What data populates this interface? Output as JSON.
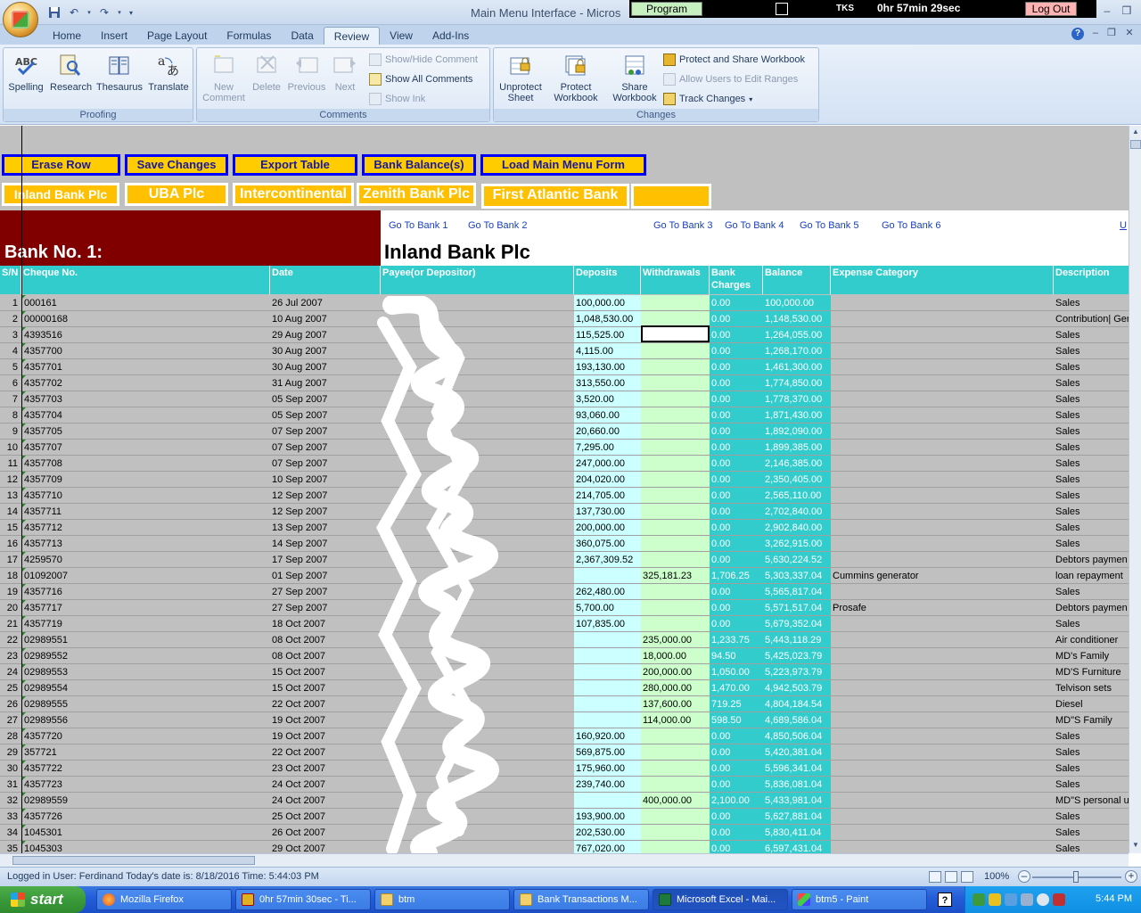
{
  "window": {
    "title": "Main Menu Interface - Micros",
    "program_label": "Program",
    "tks_label": "TKS",
    "timer": "0hr 57min 29sec",
    "logout_label": "Log Out",
    "minimize": "–",
    "restore": "❒",
    "close": "✕"
  },
  "ribbon": {
    "tabs": [
      "Home",
      "Insert",
      "Page Layout",
      "Formulas",
      "Data",
      "Review",
      "View",
      "Add-Ins"
    ],
    "active_tab": "Review",
    "groups": {
      "proofing": {
        "label": "Proofing",
        "buttons": [
          "Spelling",
          "Research",
          "Thesaurus",
          "Translate"
        ]
      },
      "comments": {
        "label": "Comments",
        "new_comment": "New Comment",
        "delete": "Delete",
        "previous": "Previous",
        "next": "Next",
        "show_hide": "Show/Hide Comment",
        "show_all": "Show All Comments",
        "show_ink": "Show Ink"
      },
      "changes": {
        "label": "Changes",
        "unprotect_sheet": "Unprotect Sheet",
        "protect_workbook": "Protect Workbook",
        "share_workbook": "Share Workbook",
        "protect_share": "Protect and Share Workbook",
        "allow_users": "Allow Users to Edit Ranges",
        "track_changes": "Track Changes"
      }
    }
  },
  "actions": [
    "Erase Row",
    "Save Changes",
    "Export Table",
    "Bank Balance(s)",
    "Load Main Menu Form"
  ],
  "banks": [
    "Inland Bank Plc",
    "UBA Plc",
    "Intercontinental",
    "Zenith Bank Plc",
    "First Atlantic Bank",
    ""
  ],
  "goto_links": [
    "Go To Bank 1",
    "Go To Bank 2",
    "Go To Bank 3",
    "Go To Bank 4",
    "Go To Bank 5",
    "Go To Bank 6",
    "U"
  ],
  "bank_no": "Bank No. 1:",
  "bank_title": "Inland Bank Plc",
  "table": {
    "headers": {
      "sn": "S/N",
      "cheque": "Cheque No.",
      "date": "Date",
      "payee": "Payee(or Depositor)",
      "deposits": "Deposits",
      "withdrawals": "Withdrawals",
      "charges": "Bank Charges",
      "balance": "Balance",
      "expense": "Expense Category",
      "description": "Description"
    },
    "rows": [
      {
        "sn": "1",
        "cheque": "000161",
        "date": "26 Jul 2007",
        "dep": "100,000.00",
        "wd": "",
        "chg": "0.00",
        "bal": "100,000.00",
        "exp": "",
        "desc": "Sales"
      },
      {
        "sn": "2",
        "cheque": "00000168",
        "date": "10 Aug 2007",
        "dep": "1,048,530.00",
        "wd": "",
        "chg": "0.00",
        "bal": "1,148,530.00",
        "exp": "",
        "desc": "Contribution| Ger"
      },
      {
        "sn": "3",
        "cheque": "4393516",
        "date": "29 Aug 2007",
        "dep": "115,525.00",
        "wd": "",
        "chg": "0.00",
        "bal": "1,264,055.00",
        "exp": "",
        "desc": "Sales"
      },
      {
        "sn": "4",
        "cheque": "4357700",
        "date": "30 Aug 2007",
        "dep": "4,115.00",
        "wd": "",
        "chg": "0.00",
        "bal": "1,268,170.00",
        "exp": "",
        "desc": "Sales"
      },
      {
        "sn": "5",
        "cheque": "4357701",
        "date": "30 Aug 2007",
        "dep": "193,130.00",
        "wd": "",
        "chg": "0.00",
        "bal": "1,461,300.00",
        "exp": "",
        "desc": "Sales"
      },
      {
        "sn": "6",
        "cheque": "4357702",
        "date": "31 Aug 2007",
        "dep": "313,550.00",
        "wd": "",
        "chg": "0.00",
        "bal": "1,774,850.00",
        "exp": "",
        "desc": "Sales"
      },
      {
        "sn": "7",
        "cheque": "4357703",
        "date": "05 Sep 2007",
        "dep": "3,520.00",
        "wd": "",
        "chg": "0.00",
        "bal": "1,778,370.00",
        "exp": "",
        "desc": "Sales"
      },
      {
        "sn": "8",
        "cheque": "4357704",
        "date": "05 Sep 2007",
        "dep": "93,060.00",
        "wd": "",
        "chg": "0.00",
        "bal": "1,871,430.00",
        "exp": "",
        "desc": "Sales"
      },
      {
        "sn": "9",
        "cheque": "4357705",
        "date": "07 Sep 2007",
        "dep": "20,660.00",
        "wd": "",
        "chg": "0.00",
        "bal": "1,892,090.00",
        "exp": "",
        "desc": "Sales"
      },
      {
        "sn": "10",
        "cheque": "4357707",
        "date": "07 Sep 2007",
        "dep": "7,295.00",
        "wd": "",
        "chg": "0.00",
        "bal": "1,899,385.00",
        "exp": "",
        "desc": "Sales"
      },
      {
        "sn": "11",
        "cheque": "4357708",
        "date": "07 Sep 2007",
        "dep": "247,000.00",
        "wd": "",
        "chg": "0.00",
        "bal": "2,146,385.00",
        "exp": "",
        "desc": "Sales"
      },
      {
        "sn": "12",
        "cheque": "4357709",
        "date": "10 Sep 2007",
        "dep": "204,020.00",
        "wd": "",
        "chg": "0.00",
        "bal": "2,350,405.00",
        "exp": "",
        "desc": "Sales"
      },
      {
        "sn": "13",
        "cheque": "4357710",
        "date": "12 Sep 2007",
        "dep": "214,705.00",
        "wd": "",
        "chg": "0.00",
        "bal": "2,565,110.00",
        "exp": "",
        "desc": "Sales"
      },
      {
        "sn": "14",
        "cheque": "4357711",
        "date": "12 Sep 2007",
        "dep": "137,730.00",
        "wd": "",
        "chg": "0.00",
        "bal": "2,702,840.00",
        "exp": "",
        "desc": "Sales"
      },
      {
        "sn": "15",
        "cheque": "4357712",
        "date": "13 Sep 2007",
        "dep": "200,000.00",
        "wd": "",
        "chg": "0.00",
        "bal": "2,902,840.00",
        "exp": "",
        "desc": "Sales"
      },
      {
        "sn": "16",
        "cheque": "4357713",
        "date": "14 Sep 2007",
        "dep": "360,075.00",
        "wd": "",
        "chg": "0.00",
        "bal": "3,262,915.00",
        "exp": "",
        "desc": "Sales"
      },
      {
        "sn": "17",
        "cheque": "4259570",
        "date": "17 Sep 2007",
        "dep": "2,367,309.52",
        "wd": "",
        "chg": "0.00",
        "bal": "5,630,224.52",
        "exp": "",
        "desc": "Debtors paymen"
      },
      {
        "sn": "18",
        "cheque": "01092007",
        "date": "01 Sep 2007",
        "dep": "",
        "wd": "325,181.23",
        "chg": "1,706.25",
        "bal": "5,303,337.04",
        "exp": "Cummins generator",
        "desc": "loan repayment"
      },
      {
        "sn": "19",
        "cheque": "4357716",
        "date": "27 Sep 2007",
        "dep": "262,480.00",
        "wd": "",
        "chg": "0.00",
        "bal": "5,565,817.04",
        "exp": "",
        "desc": "Sales"
      },
      {
        "sn": "20",
        "cheque": "4357717",
        "date": "27 Sep 2007",
        "dep": "5,700.00",
        "wd": "",
        "chg": "0.00",
        "bal": "5,571,517.04",
        "exp": "Prosafe",
        "desc": "Debtors paymen"
      },
      {
        "sn": "21",
        "cheque": "4357719",
        "date": "18 Oct 2007",
        "dep": "107,835.00",
        "wd": "",
        "chg": "0.00",
        "bal": "5,679,352.04",
        "exp": "",
        "desc": "Sales"
      },
      {
        "sn": "22",
        "cheque": "02989551",
        "date": "08 Oct 2007",
        "dep": "",
        "wd": "235,000.00",
        "chg": "1,233.75",
        "bal": "5,443,118.29",
        "exp": "",
        "desc": "Air conditioner"
      },
      {
        "sn": "23",
        "cheque": "02989552",
        "date": "08 Oct 2007",
        "dep": "",
        "wd": "18,000.00",
        "chg": "94.50",
        "bal": "5,425,023.79",
        "exp": "",
        "desc": "MD's Family"
      },
      {
        "sn": "24",
        "cheque": "02989553",
        "date": "15 Oct 2007",
        "dep": "",
        "wd": "200,000.00",
        "chg": "1,050.00",
        "bal": "5,223,973.79",
        "exp": "",
        "desc": "MD'S Furniture"
      },
      {
        "sn": "25",
        "cheque": "02989554",
        "date": "15 Oct 2007",
        "dep": "",
        "wd": "280,000.00",
        "chg": "1,470.00",
        "bal": "4,942,503.79",
        "exp": "",
        "desc": "Telvison sets"
      },
      {
        "sn": "26",
        "cheque": "02989555",
        "date": "22 Oct 2007",
        "dep": "",
        "wd": "137,600.00",
        "chg": "719.25",
        "bal": "4,804,184.54",
        "exp": "",
        "desc": "Diesel"
      },
      {
        "sn": "27",
        "cheque": "02989556",
        "date": "19 Oct 2007",
        "dep": "",
        "wd": "114,000.00",
        "chg": "598.50",
        "bal": "4,689,586.04",
        "exp": "",
        "desc": "MD\"S Family"
      },
      {
        "sn": "28",
        "cheque": "4357720",
        "date": "19 Oct 2007",
        "dep": "160,920.00",
        "wd": "",
        "chg": "0.00",
        "bal": "4,850,506.04",
        "exp": "",
        "desc": "Sales"
      },
      {
        "sn": "29",
        "cheque": "357721",
        "date": "22 Oct 2007",
        "dep": "569,875.00",
        "wd": "",
        "chg": "0.00",
        "bal": "5,420,381.04",
        "exp": "",
        "desc": "Sales"
      },
      {
        "sn": "30",
        "cheque": "4357722",
        "date": "23 Oct 2007",
        "dep": "175,960.00",
        "wd": "",
        "chg": "0.00",
        "bal": "5,596,341.04",
        "exp": "",
        "desc": "Sales"
      },
      {
        "sn": "31",
        "cheque": "4357723",
        "date": "24 Oct 2007",
        "dep": "239,740.00",
        "wd": "",
        "chg": "0.00",
        "bal": "5,836,081.04",
        "exp": "",
        "desc": "Sales"
      },
      {
        "sn": "32",
        "cheque": "02989559",
        "date": "24 Oct 2007",
        "dep": "",
        "wd": "400,000.00",
        "chg": "2,100.00",
        "bal": "5,433,981.04",
        "exp": "",
        "desc": "MD\"S personal u"
      },
      {
        "sn": "33",
        "cheque": "4357726",
        "date": "25 Oct 2007",
        "dep": "193,900.00",
        "wd": "",
        "chg": "0.00",
        "bal": "5,627,881.04",
        "exp": "",
        "desc": "Sales"
      },
      {
        "sn": "34",
        "cheque": "1045301",
        "date": "26 Oct 2007",
        "dep": "202,530.00",
        "wd": "",
        "chg": "0.00",
        "bal": "5,830,411.04",
        "exp": "",
        "desc": "Sales"
      },
      {
        "sn": "35",
        "cheque": "1045303",
        "date": "29 Oct 2007",
        "dep": "767,020.00",
        "wd": "",
        "chg": "0.00",
        "bal": "6,597,431.04",
        "exp": "",
        "desc": "Sales"
      }
    ]
  },
  "status": {
    "text": "Logged in User: Ferdinand Today's date is: 8/18/2016 Time: 5:44:03 PM",
    "zoom": "100%"
  },
  "taskbar": {
    "start": "start",
    "tasks": [
      "Mozilla Firefox",
      "0hr 57min 30sec - Ti...",
      "btm",
      "Bank Transactions M...",
      "Microsoft Excel - Mai...",
      "btm5 - Paint"
    ],
    "clock": "5:44 PM"
  },
  "colors": {
    "maroon": "#800000",
    "teal": "#33cccc",
    "action_fill": "#ffcc00",
    "action_border": "#0000ff"
  }
}
